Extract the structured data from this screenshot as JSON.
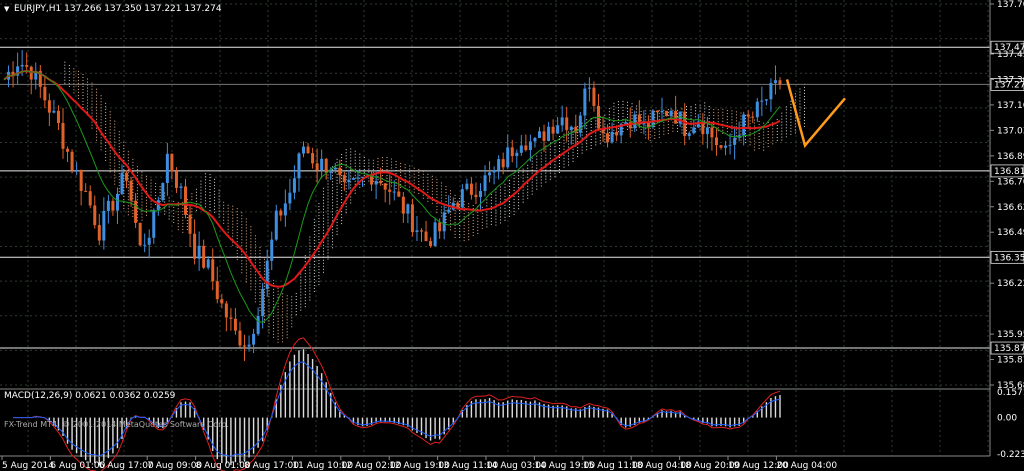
{
  "header": {
    "symbol_title": "EURJPY,H1  137.266 137.350 137.221 137.274",
    "dropdown_glyph": "▼"
  },
  "price_axis": {
    "ticks": [
      "137.700",
      "137.435",
      "137.165",
      "136.895",
      "136.760",
      "136.625",
      "136.490",
      "136.220",
      "135.950",
      "135.815",
      "135.680"
    ],
    "levels": [
      {
        "value": "137.471",
        "kind": "hline"
      },
      {
        "value": "137.274",
        "kind": "current"
      },
      {
        "value": "136.815",
        "kind": "hline"
      },
      {
        "value": "136.357",
        "kind": "hline"
      },
      {
        "value": "135.876",
        "kind": "hline"
      }
    ],
    "extra_ticks": [
      "137.300",
      "137.030"
    ]
  },
  "macd_panel": {
    "label": "MACD(12,26,9) 0.0621 0.0362 0.0259",
    "ticks": [
      "0.1571",
      "0.00",
      "-0.2235"
    ]
  },
  "time_axis": {
    "labels": [
      "5 Aug 2014",
      "6 Aug 01:00",
      "6 Aug 17:00",
      "7 Aug 09:00",
      "8 Aug 01:00",
      "8 Aug 17:00",
      "11 Aug 10:00",
      "12 Aug 02:00",
      "12 Aug 19:00",
      "13 Aug 11:00",
      "14 Aug 03:00",
      "14 Aug 19:00",
      "15 Aug 11:00",
      "18 Aug 04:00",
      "18 Aug 20:00",
      "19 Aug 12:00",
      "20 Aug 04:00"
    ]
  },
  "copyright": "FX-Trend MT4, © 2001-2014 MetaQuotes Software Corp.",
  "colors": {
    "background": "#000000",
    "grid": "#2e3a2e",
    "bull_candle": "#3f8fe0",
    "bear_candle": "#e0622a",
    "ma_red": "#e01818",
    "ma_green": "#1a9a1a",
    "cloud_white": "#d9d9d9",
    "cloud_tan": "#e6b08a",
    "projection": "#ff9a1c",
    "axis_text": "#ffffff"
  },
  "chart_data": {
    "type": "candlestick",
    "symbol": "EURJPY",
    "timeframe": "H1",
    "ohlc_header": {
      "open": 137.266,
      "high": 137.35,
      "low": 137.221,
      "close": 137.274
    },
    "ylim": [
      135.68,
      137.7
    ],
    "close_path": [
      137.3,
      137.4,
      137.35,
      137.2,
      137.05,
      136.85,
      136.7,
      136.5,
      136.65,
      136.8,
      136.4,
      136.55,
      136.9,
      136.7,
      136.4,
      136.3,
      136.1,
      135.95,
      135.9,
      136.2,
      136.55,
      136.7,
      136.95,
      136.85,
      136.85,
      136.7,
      136.75,
      136.8,
      136.75,
      136.65,
      136.55,
      136.45,
      136.5,
      136.65,
      136.7,
      136.75,
      136.8,
      136.9,
      137.0,
      136.95,
      137.05,
      137.1,
      137.05,
      137.3,
      137.0,
      137.05,
      137.1,
      137.05,
      137.1,
      137.15,
      137.05,
      137.1,
      137.0,
      136.9,
      137.05,
      137.1,
      137.2,
      137.274
    ],
    "projection_path": [
      137.3,
      136.95,
      137.2
    ],
    "macd": {
      "macd": 0.0621,
      "signal": 0.0362,
      "histogram": 0.0259,
      "ylim": [
        -0.2235,
        0.1571
      ]
    }
  }
}
